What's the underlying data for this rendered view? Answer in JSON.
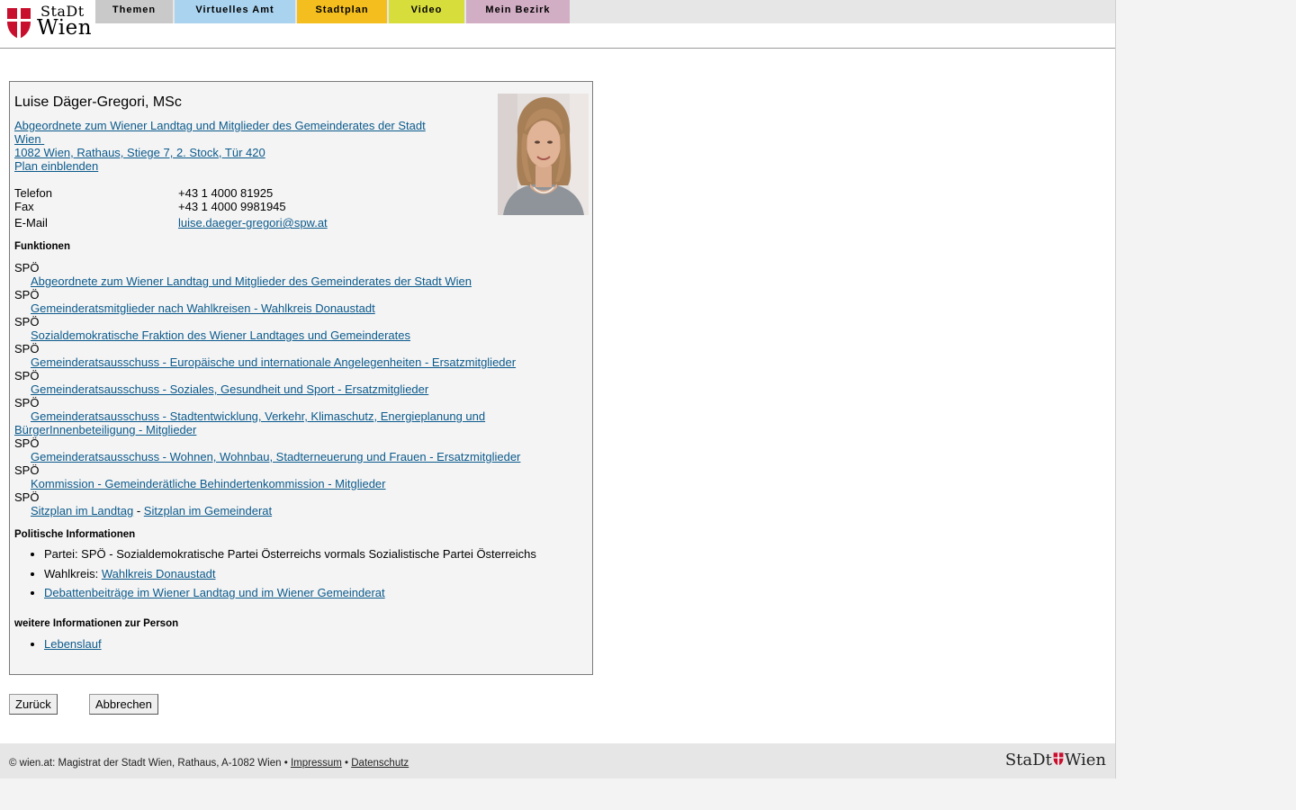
{
  "brand": {
    "stadt": "StaDt",
    "wien": "Wien",
    "red": "#c8102e"
  },
  "nav": {
    "tabs": [
      {
        "label": "Themen",
        "color": "#c9c9c9"
      },
      {
        "label": "Virtuelles Amt",
        "color": "#a9d3ef"
      },
      {
        "label": "Stadtplan",
        "color": "#f4bf1e"
      },
      {
        "label": "Video",
        "color": "#d7dd3b"
      },
      {
        "label": "Mein Bezirk",
        "color": "#d2aec5"
      }
    ]
  },
  "person": {
    "name": "Luise Däger-Gregori, MSc",
    "role_line1": "Abgeordnete zum Wiener Landtag und Mitglieder des Gemeinderates der Stadt",
    "role_line2": "Wien",
    "address": "1082 Wien, Rathaus, Stiege 7, 2. Stock, Tür 420",
    "plan_link": "Plan einblenden",
    "contact": {
      "telefon_label": "Telefon",
      "telefon": "+43 1 4000 81925",
      "fax_label": "Fax",
      "fax": "+43 1 4000 9981945",
      "email_label": "E-Mail",
      "email": "luise.daeger-gregori@spw.at"
    }
  },
  "functions": {
    "title": "Funktionen",
    "items": [
      {
        "party": "SPÖ",
        "text": "Abgeordnete zum Wiener Landtag und Mitglieder des Gemeinderates der Stadt Wien"
      },
      {
        "party": "SPÖ",
        "text": "Gemeinderatsmitglieder nach Wahlkreisen - Wahlkreis Donaustadt"
      },
      {
        "party": "SPÖ",
        "text": "Sozialdemokratische Fraktion des Wiener Landtages und Gemeinderates"
      },
      {
        "party": "SPÖ",
        "text": "Gemeinderatsausschuss - Europäische und internationale Angelegenheiten - Ersatzmitglieder"
      },
      {
        "party": "SPÖ",
        "text": "Gemeinderatsausschuss - Soziales, Gesundheit und Sport - Ersatzmitglieder"
      },
      {
        "party": "SPÖ",
        "text": "Gemeinderatsausschuss - Stadtentwicklung, Verkehr, Klimaschutz, Energieplanung und BürgerInnenbeteiligung - Mitglieder"
      },
      {
        "party": "SPÖ",
        "text": "Gemeinderatsausschuss - Wohnen, Wohnbau, Stadterneuerung und Frauen - Ersatzmitglieder"
      },
      {
        "party": "SPÖ",
        "text": "Kommission - Gemeinderätliche Behindertenkommission - Mitglieder"
      }
    ],
    "last_party": "SPÖ",
    "sitzplan_landtag": "Sitzplan im Landtag",
    "separator": "-",
    "sitzplan_gemeinderat": "Sitzplan im Gemeinderat"
  },
  "political": {
    "title": "Politische Informationen",
    "partei": "Partei: SPÖ - Sozialdemokratische Partei Österreichs vormals Sozialistische Partei Österreichs",
    "wahlkreis_label": "Wahlkreis:",
    "wahlkreis_link": "Wahlkreis Donaustadt",
    "debatten": "Debattenbeiträge im Wiener Landtag und im Wiener Gemeinderat"
  },
  "weitere": {
    "title": "weitere Informationen zur Person",
    "lebenslauf": "Lebenslauf"
  },
  "buttons": {
    "back": "Zurück",
    "cancel": "Abbrechen"
  },
  "footer": {
    "text": "© wien.at: Magistrat der Stadt Wien, Rathaus, A-1082 Wien •",
    "impressum": "Impressum",
    "bullet": "•",
    "datenschutz": "Datenschutz",
    "logo_stadt": "StaDt",
    "logo_wien": "Wien"
  }
}
